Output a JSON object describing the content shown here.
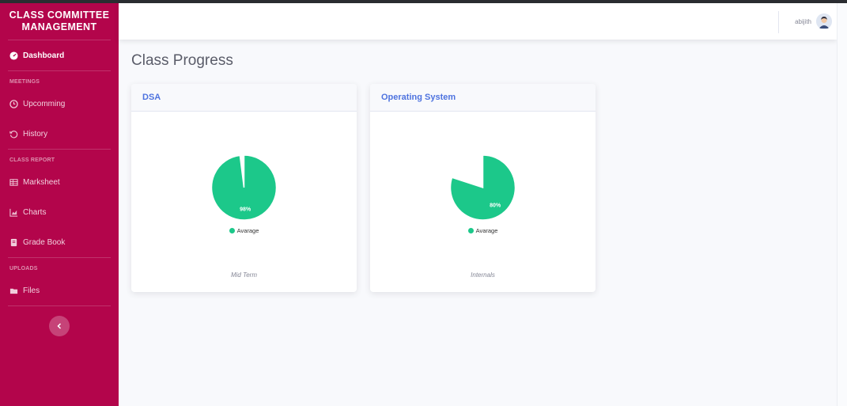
{
  "sidebar": {
    "brand": "CLASS COMMITTEE MANAGEMENT",
    "dashboard": "Dashboard",
    "sections": {
      "meetings": "MEETINGS",
      "class_report": "CLASS REPORT",
      "uploads": "UPLOADS"
    },
    "items": {
      "upcomming": "Upcomming",
      "history": "History",
      "marksheet": "Marksheet",
      "charts": "Charts",
      "grade_book": "Grade Book",
      "files": "Files"
    },
    "toggle_icon": "chevron-left-icon"
  },
  "topbar": {
    "user_name": "abijith",
    "avatar_icon": "user-avatar-icon"
  },
  "main": {
    "title": "Class Progress"
  },
  "colors": {
    "sidebar": "#b3054b",
    "accent": "#4e73df",
    "pie": "#1cc88a"
  },
  "chart_data": [
    {
      "type": "pie",
      "title": "DSA",
      "categories": [
        "Avarage",
        ""
      ],
      "values": [
        98,
        2
      ],
      "slice_label": "98%",
      "legend": [
        "Avarage"
      ],
      "caption": "Mid Term"
    },
    {
      "type": "pie",
      "title": "Operating System",
      "categories": [
        "Avarage",
        ""
      ],
      "values": [
        80,
        20
      ],
      "slice_label": "80%",
      "legend": [
        "Avarage"
      ],
      "caption": "Internals"
    }
  ]
}
